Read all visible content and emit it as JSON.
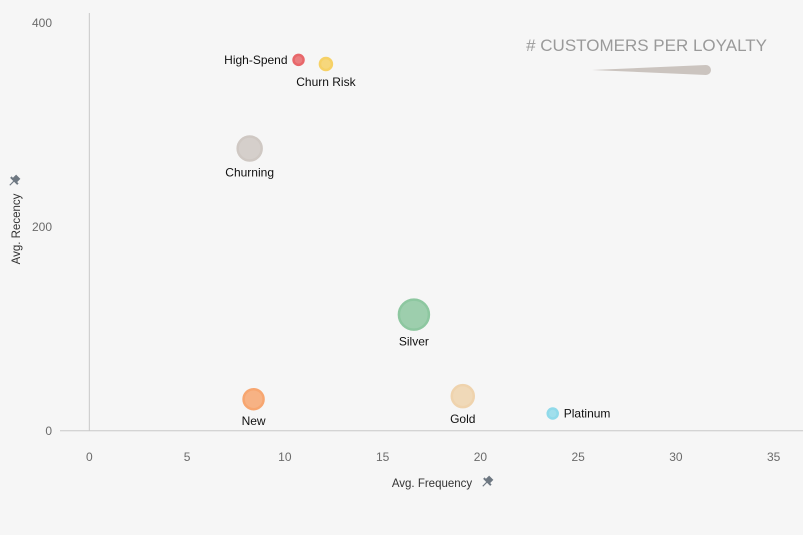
{
  "chart_data": {
    "type": "scatter",
    "title": "",
    "xlabel": "Avg. Frequency",
    "ylabel": "Avg. Recency",
    "xlim": [
      -1.5,
      36.5
    ],
    "ylim": [
      -10,
      410
    ],
    "x_ticks": [
      0,
      5,
      10,
      15,
      20,
      25,
      30,
      35
    ],
    "y_ticks": [
      0,
      200,
      400
    ],
    "grid": false,
    "size_legend_title": "# CUSTOMERS PER LOYALTY",
    "points": [
      {
        "label": "High-Spend",
        "x": 10.7,
        "y": 364,
        "size": 10,
        "color": "#e8676a",
        "label_pos": "left"
      },
      {
        "label": "Churn Risk",
        "x": 12.1,
        "y": 360,
        "size": 12,
        "color": "#f6d166",
        "label_pos": "below"
      },
      {
        "label": "Churning",
        "x": 8.2,
        "y": 277,
        "size": 24,
        "color": "#cfc8c3",
        "label_pos": "below"
      },
      {
        "label": "Silver",
        "x": 16.6,
        "y": 114,
        "size": 30,
        "color": "#8dc7a0",
        "label_pos": "below"
      },
      {
        "label": "New",
        "x": 8.4,
        "y": 31,
        "size": 20,
        "color": "#f7a670",
        "label_pos": "below"
      },
      {
        "label": "Gold",
        "x": 19.1,
        "y": 34,
        "size": 22,
        "color": "#efd3ad",
        "label_pos": "below"
      },
      {
        "label": "Platinum",
        "x": 23.7,
        "y": 17,
        "size": 10,
        "color": "#90daea",
        "label_pos": "right"
      }
    ],
    "colors": {
      "axis": "#c8c8c8",
      "legend_shape": "#cbc4bf",
      "pin": "#6e7882"
    }
  }
}
